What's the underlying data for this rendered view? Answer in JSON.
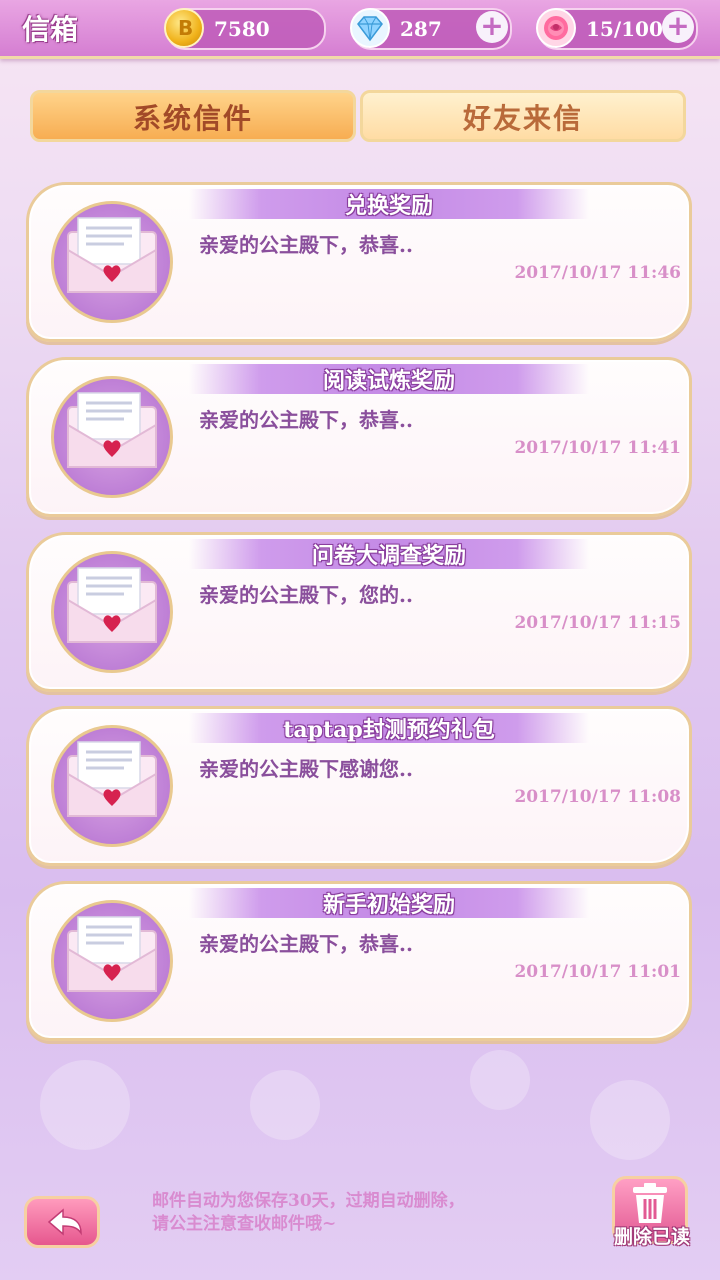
{
  "header": {
    "title": "信箱",
    "coins": "7580",
    "diamonds": "287",
    "stamina": "15/100"
  },
  "tabs": [
    {
      "label": "系统信件",
      "active": true
    },
    {
      "label": "好友来信",
      "active": false
    }
  ],
  "mails": [
    {
      "title": "兑换奖励",
      "preview": "亲爱的公主殿下，恭喜..",
      "time": "2017/10/17 11:46"
    },
    {
      "title": "阅读试炼奖励",
      "preview": "亲爱的公主殿下，恭喜..",
      "time": "2017/10/17 11:41"
    },
    {
      "title": "问卷大调查奖励",
      "preview": "亲爱的公主殿下，您的..",
      "time": "2017/10/17 11:15"
    },
    {
      "title": "taptap封测预约礼包",
      "preview": "亲爱的公主殿下感谢您..",
      "time": "2017/10/17 11:08"
    },
    {
      "title": "新手初始奖励",
      "preview": "亲爱的公主殿下，恭喜..",
      "time": "2017/10/17 11:01"
    }
  ],
  "footer": {
    "notice_line1": "邮件自动为您保存30天，过期自动删除，",
    "notice_line2": "请公主注意查收邮件哦~",
    "delete_label": "删除已读"
  },
  "icons": {
    "coin": "coin-icon",
    "diamond": "diamond-icon",
    "stamina": "rose-icon",
    "mail": "envelope-heart-icon",
    "back": "back-arrow-icon",
    "delete": "trash-icon"
  }
}
